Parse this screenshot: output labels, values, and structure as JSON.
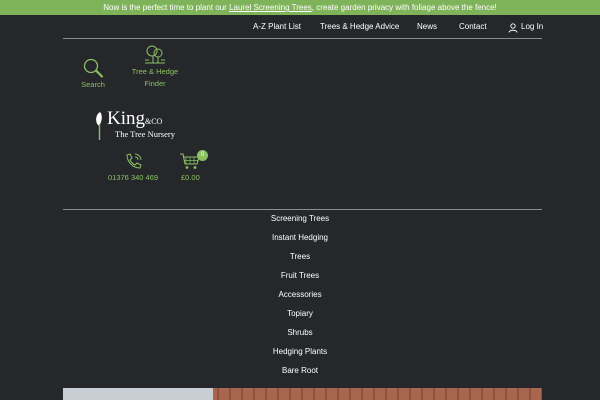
{
  "promo": {
    "before": "Now is the perfect time to plant our ",
    "link": "Laurel Screening Trees",
    "after": ", create garden privacy with foliage above the fence!",
    "bg_color": "#7fb35a"
  },
  "topnav": {
    "items": [
      "A-Z Plant List",
      "Trees & Hedge Advice",
      "News",
      "Contact"
    ],
    "login": "Log In"
  },
  "tools": {
    "search": "Search",
    "finder_line1": "Tree & Hedge",
    "finder_line2": "Finder"
  },
  "logo": {
    "brand": "King",
    "suffix": "&CO",
    "tagline": "The Tree Nursery"
  },
  "contact": {
    "phone": "01376 340 469"
  },
  "cart": {
    "total": "£0.00",
    "count": "0"
  },
  "menu": {
    "items": [
      "Screening Trees",
      "Instant Hedging",
      "Trees",
      "Fruit Trees",
      "Accessories",
      "Topiary",
      "Shrubs",
      "Hedging Plants",
      "Bare Root"
    ]
  },
  "colors": {
    "background": "#25272b",
    "accent": "#8cc063"
  },
  "icons": [
    "search-icon",
    "tree-finder-icon",
    "phone-icon",
    "cart-icon",
    "user-icon",
    "tree-logo-icon"
  ]
}
